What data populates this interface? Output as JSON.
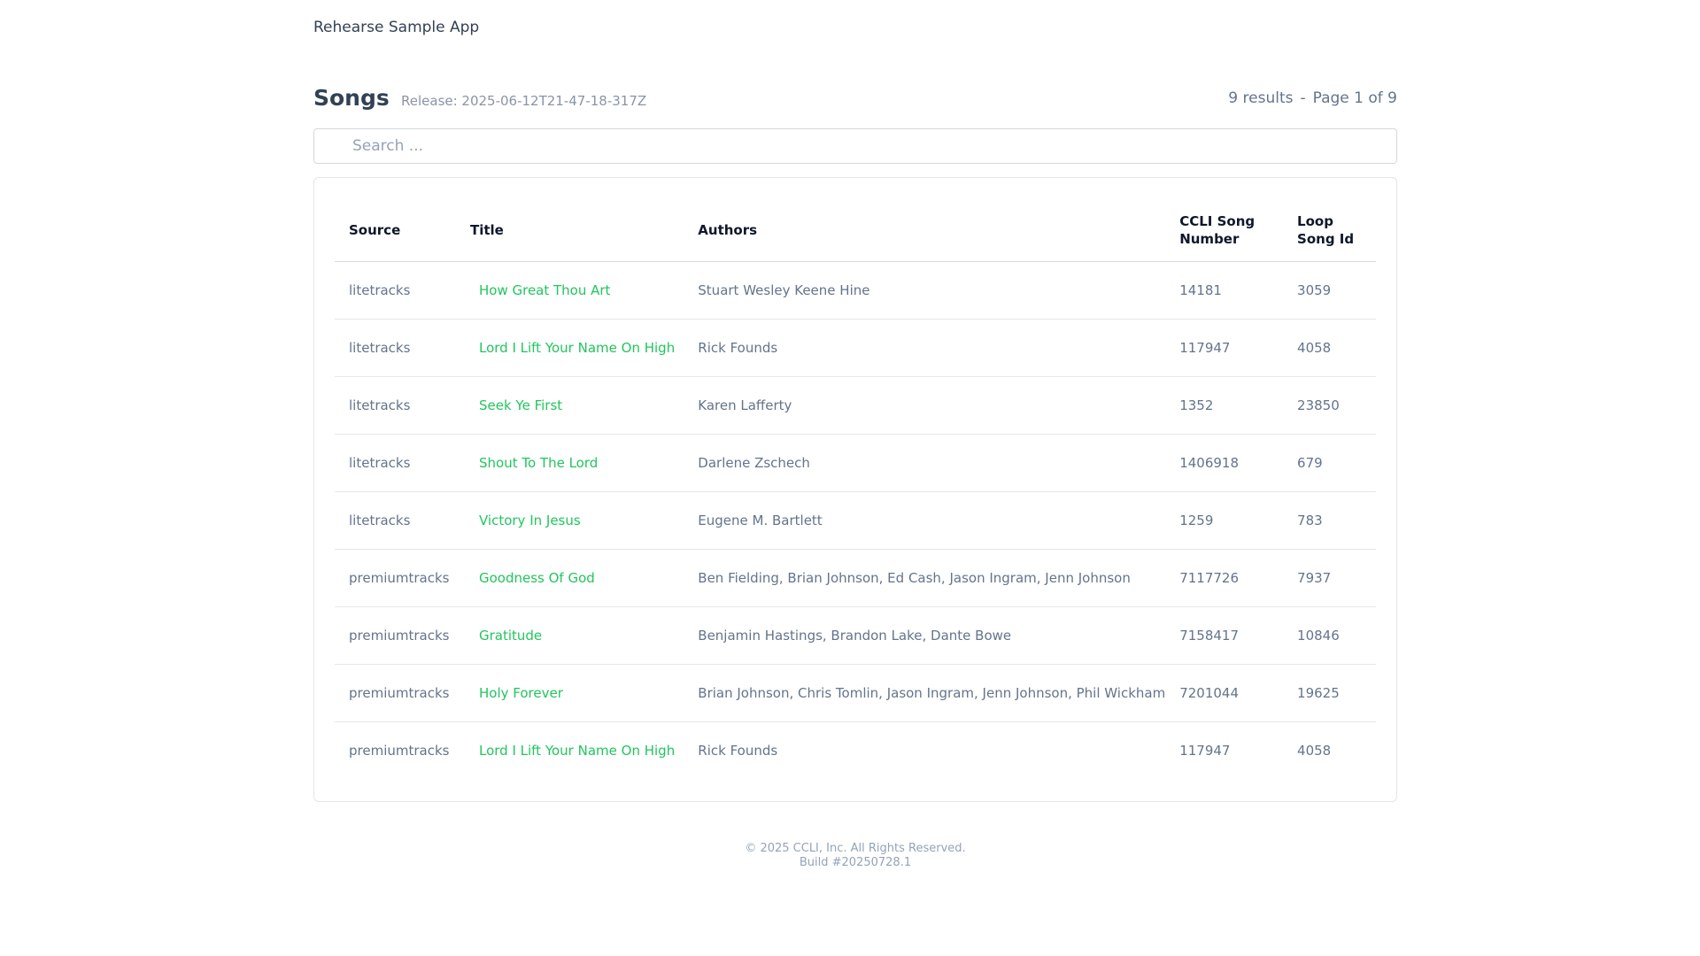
{
  "app": {
    "title": "Rehearse Sample App"
  },
  "header": {
    "title": "Songs",
    "release": "Release: 2025-06-12T21-47-18-317Z",
    "results": "9 results",
    "separator": "-",
    "page": "Page 1 of 9"
  },
  "search": {
    "placeholder": "Search ...",
    "value": "",
    "icon": "search-icon"
  },
  "table": {
    "columns": {
      "source": "Source",
      "title": "Title",
      "authors": "Authors",
      "ccli": "CCLI Song Number",
      "loop": "Loop Song Id"
    },
    "rows": [
      {
        "source": "litetracks",
        "title": "How Great Thou Art",
        "authors": "Stuart Wesley Keene Hine",
        "ccli": "14181",
        "loop": "3059"
      },
      {
        "source": "litetracks",
        "title": "Lord I Lift Your Name On High",
        "authors": "Rick Founds",
        "ccli": "117947",
        "loop": "4058"
      },
      {
        "source": "litetracks",
        "title": "Seek Ye First",
        "authors": "Karen Lafferty",
        "ccli": "1352",
        "loop": "23850"
      },
      {
        "source": "litetracks",
        "title": "Shout To The Lord",
        "authors": "Darlene Zschech",
        "ccli": "1406918",
        "loop": "679"
      },
      {
        "source": "litetracks",
        "title": "Victory In Jesus",
        "authors": "Eugene M. Bartlett",
        "ccli": "1259",
        "loop": "783"
      },
      {
        "source": "premiumtracks",
        "title": "Goodness Of God",
        "authors": "Ben Fielding, Brian Johnson, Ed Cash, Jason Ingram, Jenn Johnson",
        "ccli": "7117726",
        "loop": "7937"
      },
      {
        "source": "premiumtracks",
        "title": "Gratitude",
        "authors": "Benjamin Hastings, Brandon Lake, Dante Bowe",
        "ccli": "7158417",
        "loop": "10846"
      },
      {
        "source": "premiumtracks",
        "title": "Holy Forever",
        "authors": "Brian Johnson, Chris Tomlin, Jason Ingram, Jenn Johnson, Phil Wickham",
        "ccli": "7201044",
        "loop": "19625"
      },
      {
        "source": "premiumtracks",
        "title": "Lord I Lift Your Name On High",
        "authors": "Rick Founds",
        "ccli": "117947",
        "loop": "4058"
      }
    ]
  },
  "footer": {
    "copyright": "© 2025 CCLI, Inc. All Rights Reserved.",
    "build": "Build #20250728.1"
  },
  "colors": {
    "accent": "#22c55e",
    "text": "#334155",
    "muted": "#64748b"
  }
}
